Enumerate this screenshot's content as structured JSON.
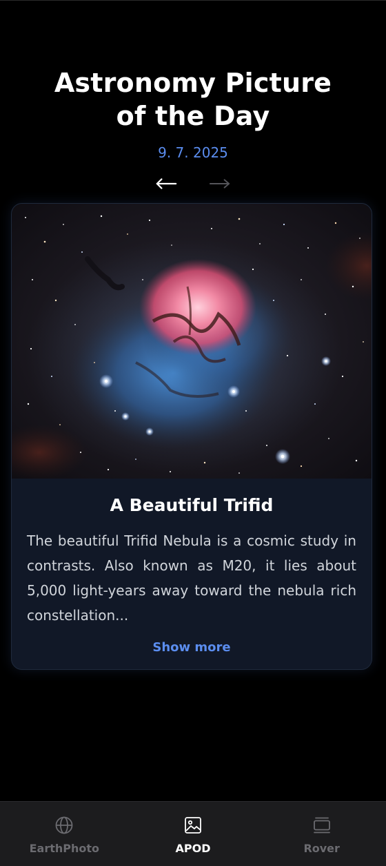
{
  "header": {
    "title_line1": "Astronomy Picture",
    "title_line2": "of the Day",
    "date": "9. 7. 2025"
  },
  "navigation": {
    "prev_icon": "arrow-left-icon",
    "next_icon": "arrow-right-icon",
    "next_disabled": true
  },
  "apod": {
    "title": "A Beautiful Trifid",
    "description": "The beautiful Trifid Nebula is a cosmic study in contrasts. Also known as M20, it lies about 5,000 light-years away toward the nebula rich constellation...",
    "show_more_label": "Show more"
  },
  "bottom_nav": {
    "items": [
      {
        "label": "EarthPhoto",
        "icon": "globe-icon",
        "active": false
      },
      {
        "label": "APOD",
        "icon": "image-icon",
        "active": true
      },
      {
        "label": "Rover",
        "icon": "gallery-icon",
        "active": false
      }
    ]
  },
  "colors": {
    "background": "#000000",
    "accent": "#5b8def",
    "card": "#111827",
    "nav_bar": "#1c1c1e"
  }
}
